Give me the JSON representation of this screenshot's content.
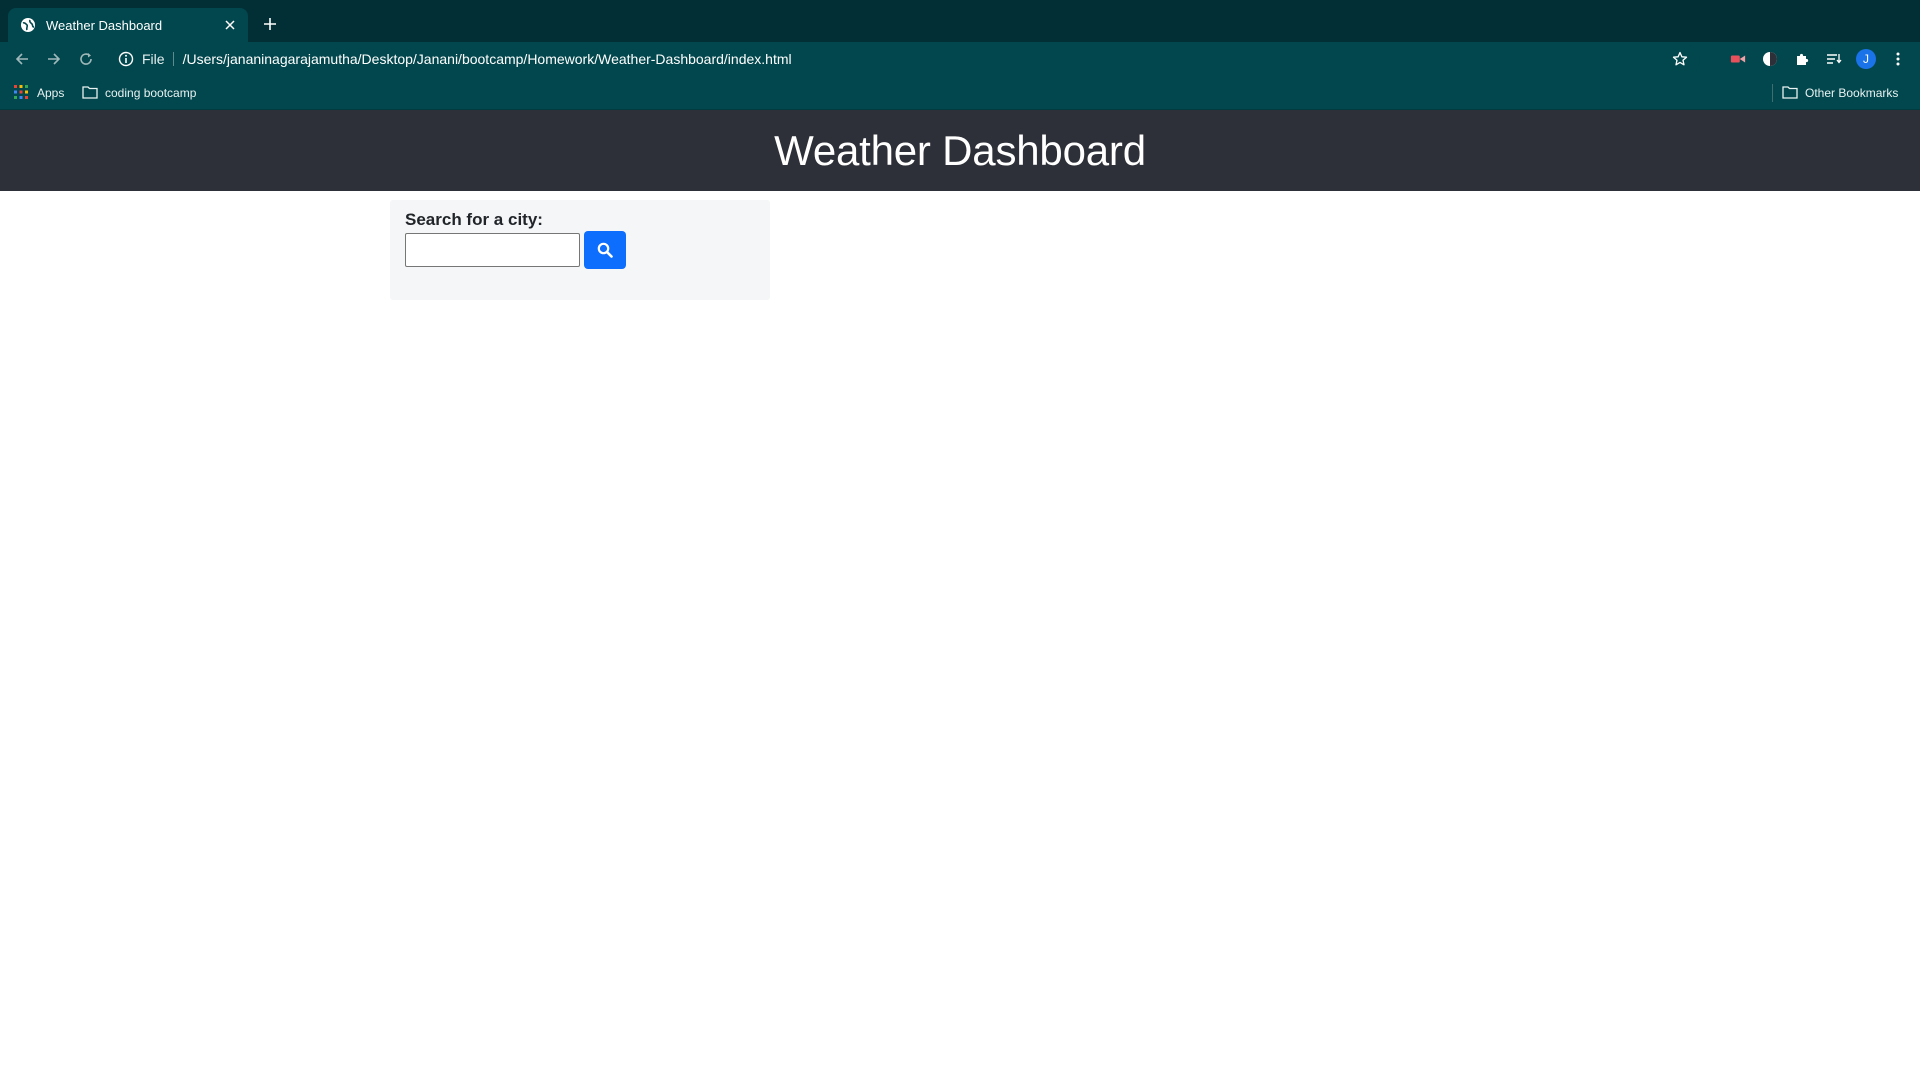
{
  "browser": {
    "tab": {
      "title": "Weather Dashboard"
    },
    "address_bar": {
      "scheme": "File",
      "url": "/Users/jananinagarajamutha/Desktop/Janani/bootcamp/Homework/Weather-Dashboard/index.html"
    },
    "profile_initial": "J",
    "bookmarks": {
      "apps_label": "Apps",
      "folder_label": "coding bootcamp",
      "other_label": "Other Bookmarks"
    },
    "colors": {
      "frame": "#012f35",
      "toolbar": "#02474d",
      "profile": "#1a73e8"
    }
  },
  "page": {
    "header": {
      "title": "Weather Dashboard"
    },
    "search": {
      "label": "Search for a city:",
      "input_value": "",
      "button_icon": "search-icon"
    },
    "colors": {
      "header_bg": "#2d3038",
      "button_bg": "#0d6efd",
      "panel_bg": "#f5f6f7"
    }
  }
}
